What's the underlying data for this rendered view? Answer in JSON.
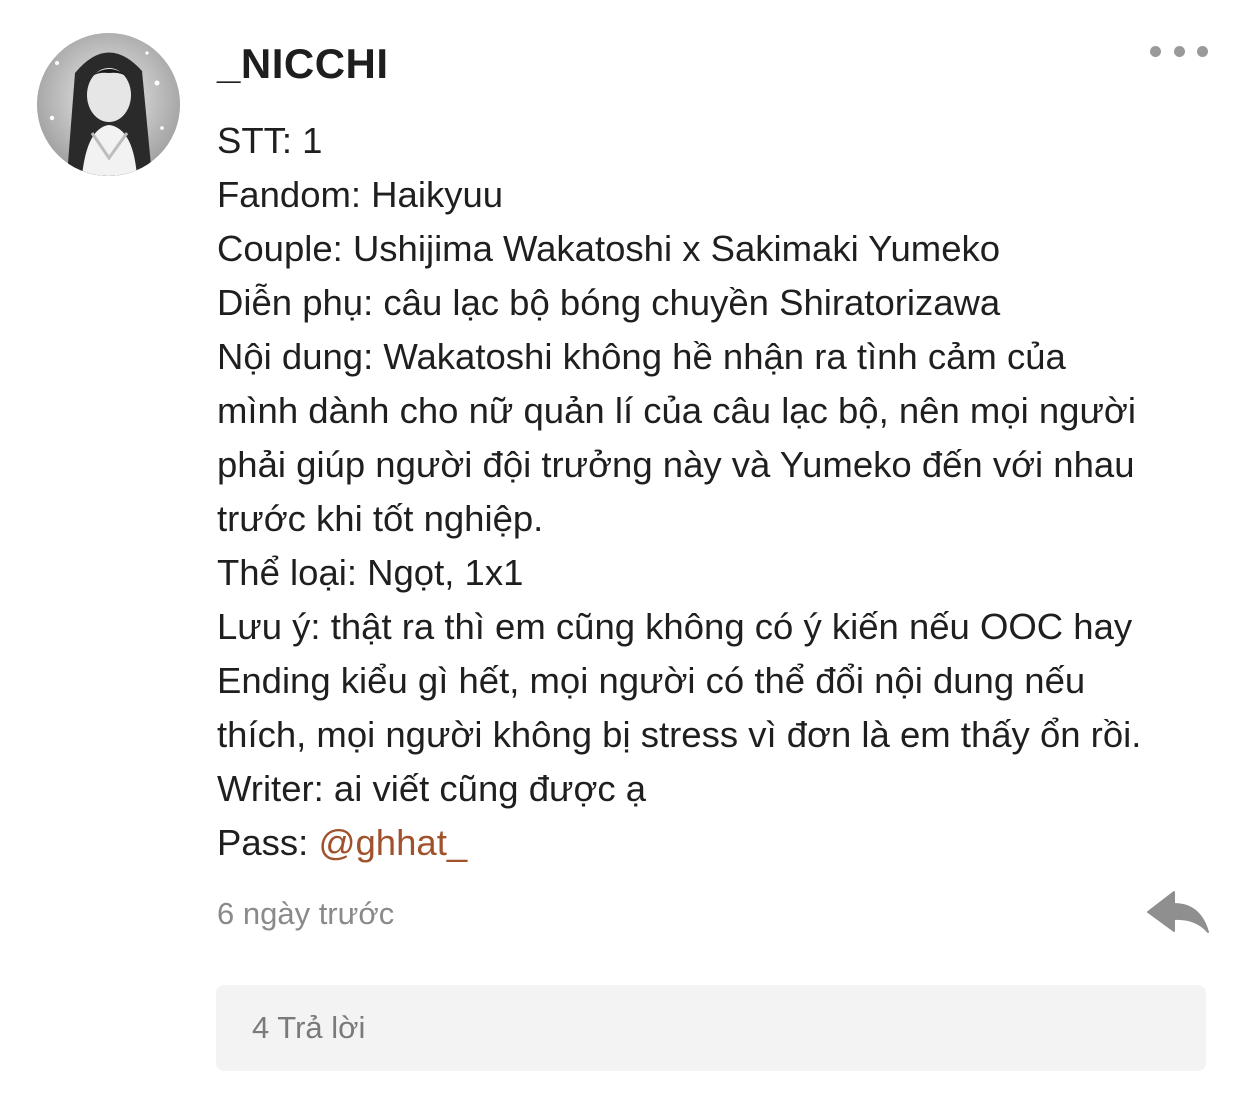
{
  "comment": {
    "username": "_NICCHI",
    "lines": [
      "STT: 1",
      "Fandom: Haikyuu",
      "Couple: Ushijima Wakatoshi x Sakimaki Yumeko",
      "Diễn phụ: câu lạc bộ bóng chuyền Shiratorizawa",
      "Nội dung: Wakatoshi không hề nhận ra tình cảm của",
      "mình dành cho nữ quản lí của câu lạc bộ, nên mọi người",
      "phải giúp người đội trưởng này và Yumeko đến với nhau",
      "trước khi tốt nghiệp.",
      "Thể loại: Ngọt, 1x1",
      "Lưu ý: thật ra thì em cũng không có ý kiến nếu OOC hay",
      "Ending kiểu gì hết, mọi người có thể đổi nội dung nếu",
      "thích, mọi người không bị stress vì đơn là em thấy ổn rồi.",
      "Writer: ai viết cũng được ạ"
    ],
    "pass_label": "Pass: ",
    "pass_mention": "@ghhat_",
    "timestamp": "6 ngày trước",
    "replies_label": "4 Trả lời"
  },
  "icons": {
    "avatar": "avatar",
    "more": "more-options-icon",
    "reply": "reply-arrow-icon"
  },
  "colors": {
    "mention": "#a0522d",
    "muted": "#8a8a8a",
    "replies_background": "#f3f3f3",
    "icon_gray": "#9a9a9a"
  }
}
